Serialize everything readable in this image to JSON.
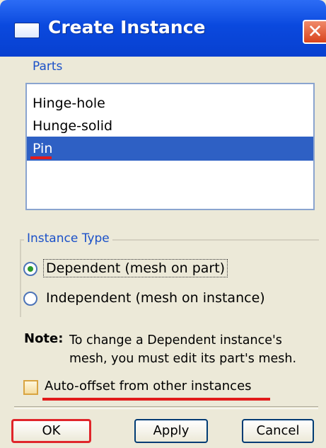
{
  "window": {
    "title": "Create Instance",
    "close_glyph": "✕"
  },
  "parts": {
    "label": "Parts",
    "items": [
      {
        "label": "Hinge-hole",
        "selected": false
      },
      {
        "label": "Hunge-solid",
        "selected": false
      },
      {
        "label": "Pin",
        "selected": true
      }
    ]
  },
  "instance_type": {
    "label": "Instance Type",
    "options": [
      {
        "label": "Dependent (mesh on part)",
        "selected": true
      },
      {
        "label": "Independent (mesh on instance)",
        "selected": false
      }
    ]
  },
  "note": {
    "label": "Note:",
    "line1": "To change a Dependent instance's",
    "line2": "mesh, you must edit its part's mesh."
  },
  "auto_offset": {
    "label": "Auto-offset from other instances",
    "checked": false
  },
  "buttons": {
    "ok": "OK",
    "apply": "Apply",
    "cancel": "Cancel"
  },
  "colors": {
    "titlebar": "#0a49de",
    "selection": "#2e60c4",
    "highlight": "#e11b1b"
  },
  "icons": {
    "window": "window-icon",
    "close": "close-icon"
  }
}
